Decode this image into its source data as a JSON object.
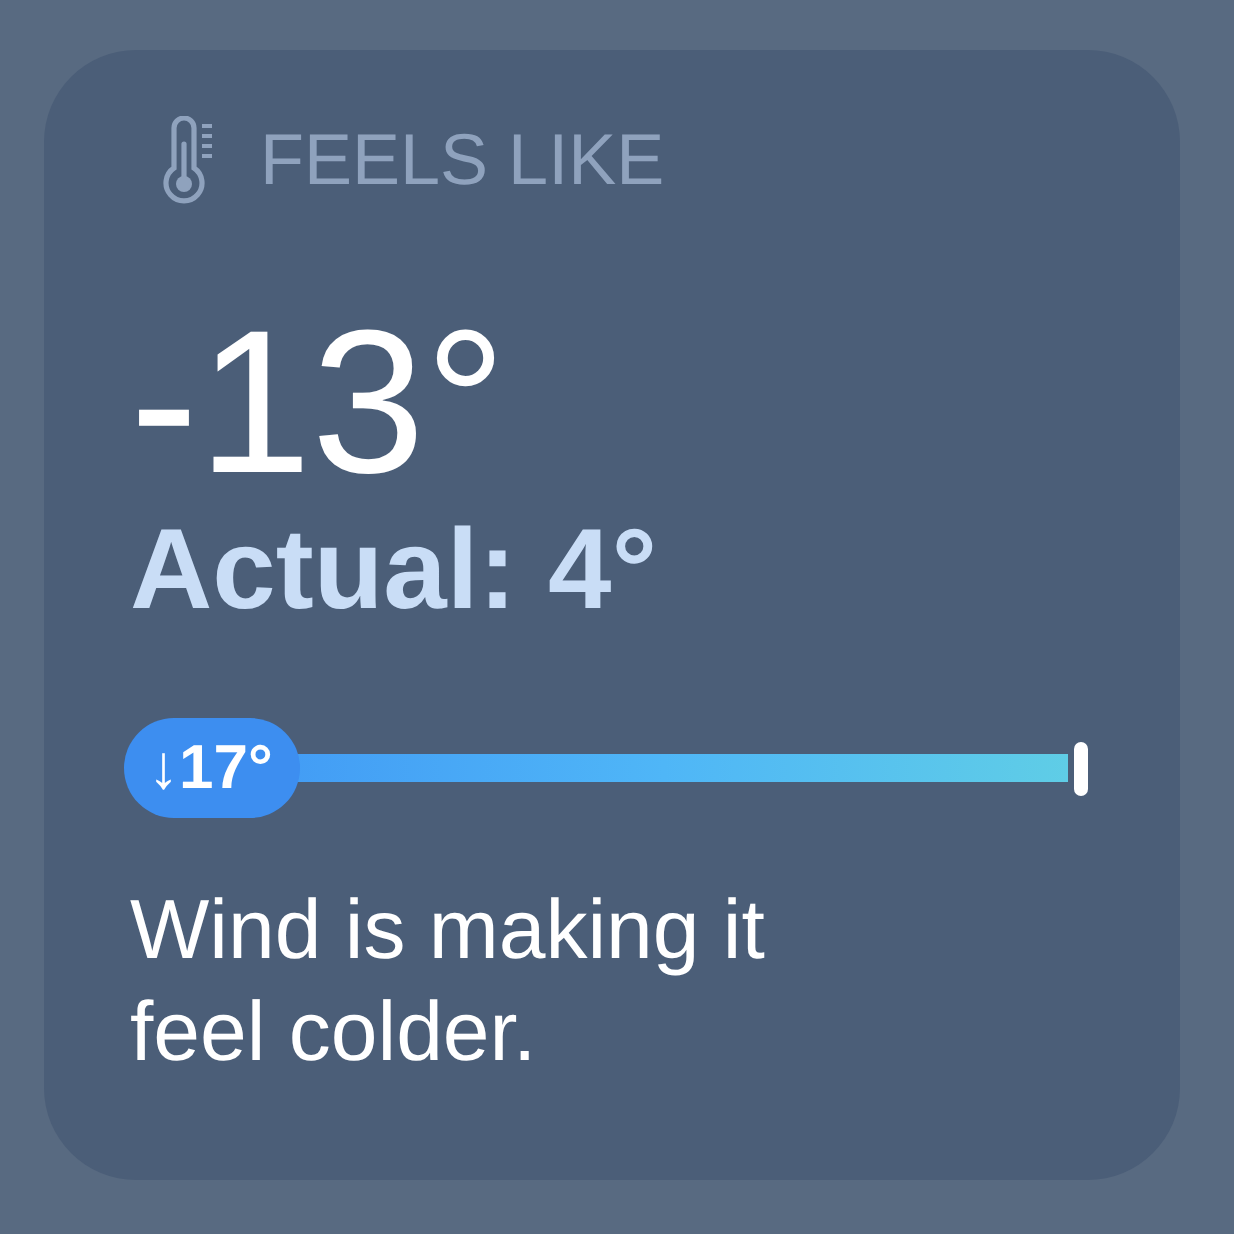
{
  "card": {
    "title": "FEELS LIKE",
    "temperature": "-13°",
    "actual": "Actual: 4°",
    "difference": {
      "label": "↓17°"
    },
    "description": "Wind is making it feel colder."
  }
}
